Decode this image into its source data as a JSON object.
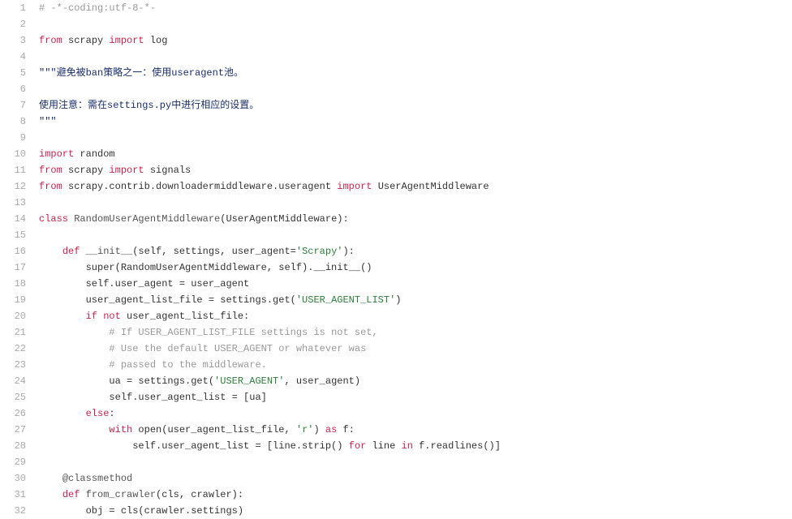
{
  "code": {
    "lines": [
      {
        "n": 1,
        "tokens": [
          {
            "c": "tok-comment",
            "t": "# -*-coding:utf-8-*-"
          }
        ]
      },
      {
        "n": 2,
        "tokens": []
      },
      {
        "n": 3,
        "tokens": [
          {
            "c": "tok-keyword",
            "t": "from"
          },
          {
            "c": "",
            "t": " scrapy "
          },
          {
            "c": "tok-keyword",
            "t": "import"
          },
          {
            "c": "",
            "t": " log"
          }
        ]
      },
      {
        "n": 4,
        "tokens": []
      },
      {
        "n": 5,
        "tokens": [
          {
            "c": "tok-docstring",
            "t": "\"\"\"避免被ban策略之一：使用useragent池。"
          }
        ]
      },
      {
        "n": 6,
        "tokens": []
      },
      {
        "n": 7,
        "tokens": [
          {
            "c": "tok-docstring",
            "t": "使用注意：需在settings.py中进行相应的设置。"
          }
        ]
      },
      {
        "n": 8,
        "tokens": [
          {
            "c": "tok-docstring",
            "t": "\"\"\""
          }
        ]
      },
      {
        "n": 9,
        "tokens": []
      },
      {
        "n": 10,
        "tokens": [
          {
            "c": "tok-keyword",
            "t": "import"
          },
          {
            "c": "",
            "t": " random"
          }
        ]
      },
      {
        "n": 11,
        "tokens": [
          {
            "c": "tok-keyword",
            "t": "from"
          },
          {
            "c": "",
            "t": " scrapy "
          },
          {
            "c": "tok-keyword",
            "t": "import"
          },
          {
            "c": "",
            "t": " signals"
          }
        ]
      },
      {
        "n": 12,
        "tokens": [
          {
            "c": "tok-keyword",
            "t": "from"
          },
          {
            "c": "",
            "t": " scrapy.contrib.downloadermiddleware.useragent "
          },
          {
            "c": "tok-keyword",
            "t": "import"
          },
          {
            "c": "",
            "t": " UserAgentMiddleware"
          }
        ]
      },
      {
        "n": 13,
        "tokens": []
      },
      {
        "n": 14,
        "tokens": [
          {
            "c": "tok-keyword",
            "t": "class"
          },
          {
            "c": "",
            "t": " "
          },
          {
            "c": "tok-def",
            "t": "RandomUserAgentMiddleware"
          },
          {
            "c": "",
            "t": "(UserAgentMiddleware):"
          }
        ]
      },
      {
        "n": 15,
        "tokens": []
      },
      {
        "n": 16,
        "tokens": [
          {
            "c": "",
            "t": "    "
          },
          {
            "c": "tok-keyword",
            "t": "def"
          },
          {
            "c": "",
            "t": " "
          },
          {
            "c": "tok-def",
            "t": "__init__"
          },
          {
            "c": "",
            "t": "(self, settings, user_agent="
          },
          {
            "c": "tok-string",
            "t": "'Scrapy'"
          },
          {
            "c": "",
            "t": "):"
          }
        ]
      },
      {
        "n": 17,
        "tokens": [
          {
            "c": "",
            "t": "        super(RandomUserAgentMiddleware, self).__init__()"
          }
        ]
      },
      {
        "n": 18,
        "tokens": [
          {
            "c": "",
            "t": "        self.user_agent = user_agent"
          }
        ]
      },
      {
        "n": 19,
        "tokens": [
          {
            "c": "",
            "t": "        user_agent_list_file = settings.get("
          },
          {
            "c": "tok-string",
            "t": "'USER_AGENT_LIST'"
          },
          {
            "c": "",
            "t": ")"
          }
        ]
      },
      {
        "n": 20,
        "tokens": [
          {
            "c": "",
            "t": "        "
          },
          {
            "c": "tok-keyword",
            "t": "if"
          },
          {
            "c": "",
            "t": " "
          },
          {
            "c": "tok-keyword",
            "t": "not"
          },
          {
            "c": "",
            "t": " user_agent_list_file:"
          }
        ]
      },
      {
        "n": 21,
        "tokens": [
          {
            "c": "",
            "t": "            "
          },
          {
            "c": "tok-comment",
            "t": "# If USER_AGENT_LIST_FILE settings is not set,"
          }
        ]
      },
      {
        "n": 22,
        "tokens": [
          {
            "c": "",
            "t": "            "
          },
          {
            "c": "tok-comment",
            "t": "# Use the default USER_AGENT or whatever was"
          }
        ]
      },
      {
        "n": 23,
        "tokens": [
          {
            "c": "",
            "t": "            "
          },
          {
            "c": "tok-comment",
            "t": "# passed to the middleware."
          }
        ]
      },
      {
        "n": 24,
        "tokens": [
          {
            "c": "",
            "t": "            ua = settings.get("
          },
          {
            "c": "tok-string",
            "t": "'USER_AGENT'"
          },
          {
            "c": "",
            "t": ", user_agent)"
          }
        ]
      },
      {
        "n": 25,
        "tokens": [
          {
            "c": "",
            "t": "            self.user_agent_list = [ua]"
          }
        ]
      },
      {
        "n": 26,
        "tokens": [
          {
            "c": "",
            "t": "        "
          },
          {
            "c": "tok-keyword",
            "t": "else"
          },
          {
            "c": "",
            "t": ":"
          }
        ]
      },
      {
        "n": 27,
        "tokens": [
          {
            "c": "",
            "t": "            "
          },
          {
            "c": "tok-keyword",
            "t": "with"
          },
          {
            "c": "",
            "t": " open(user_agent_list_file, "
          },
          {
            "c": "tok-string",
            "t": "'r'"
          },
          {
            "c": "",
            "t": ") "
          },
          {
            "c": "tok-keyword",
            "t": "as"
          },
          {
            "c": "",
            "t": " f:"
          }
        ]
      },
      {
        "n": 28,
        "tokens": [
          {
            "c": "",
            "t": "                self.user_agent_list = [line.strip() "
          },
          {
            "c": "tok-keyword",
            "t": "for"
          },
          {
            "c": "",
            "t": " line "
          },
          {
            "c": "tok-keyword",
            "t": "in"
          },
          {
            "c": "",
            "t": " f.readlines()]"
          }
        ]
      },
      {
        "n": 29,
        "tokens": []
      },
      {
        "n": 30,
        "tokens": [
          {
            "c": "",
            "t": "    "
          },
          {
            "c": "tok-decorator",
            "t": "@classmethod"
          }
        ]
      },
      {
        "n": 31,
        "tokens": [
          {
            "c": "",
            "t": "    "
          },
          {
            "c": "tok-keyword",
            "t": "def"
          },
          {
            "c": "",
            "t": " "
          },
          {
            "c": "tok-def",
            "t": "from_crawler"
          },
          {
            "c": "",
            "t": "(cls, crawler):"
          }
        ]
      },
      {
        "n": 32,
        "tokens": [
          {
            "c": "",
            "t": "        obj = cls(crawler.settings)"
          }
        ]
      }
    ]
  }
}
